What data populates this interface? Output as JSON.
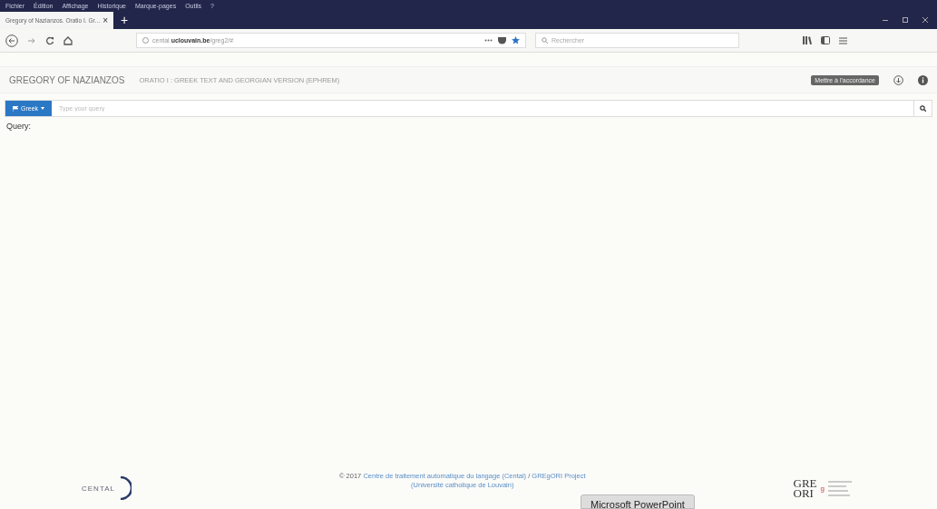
{
  "menu_bar": [
    "Fichier",
    "Édition",
    "Affichage",
    "Historique",
    "Marque-pages",
    "Outils",
    "?"
  ],
  "tab": {
    "title": "Gregory of Nazianzos. Oratio I. Gr…",
    "close": "×",
    "new_tab": "+"
  },
  "address_bar": {
    "prefix": "cental.",
    "domain": "uclouvain.be",
    "path": "/greg2/#"
  },
  "search_bar": {
    "placeholder": "Rechercher"
  },
  "header": {
    "title": "GREGORY OF NAZIANZOS",
    "subtitle": "ORATIO I : GREEK TEXT AND GEORGIAN VERSION (EPHREM)",
    "tooltip": "Mettre à l'accordance"
  },
  "query_bar": {
    "language": "Greek",
    "placeholder": "Type your query"
  },
  "query_label": "Query:",
  "footer": {
    "copyright": "© 2017",
    "link_1": "Centre de traitement automatique du langage (Cental)",
    "separator": " / ",
    "link_2": "GREgORI Project",
    "line_2": "(Université catholique de Louvain)",
    "cental_logo": "CENTAL",
    "gregori_logo_1": "GRE",
    "gregori_logo_2": "ORI",
    "gregori_logo_3": "g"
  },
  "taskbar_tooltip": "Microsoft PowerPoint"
}
